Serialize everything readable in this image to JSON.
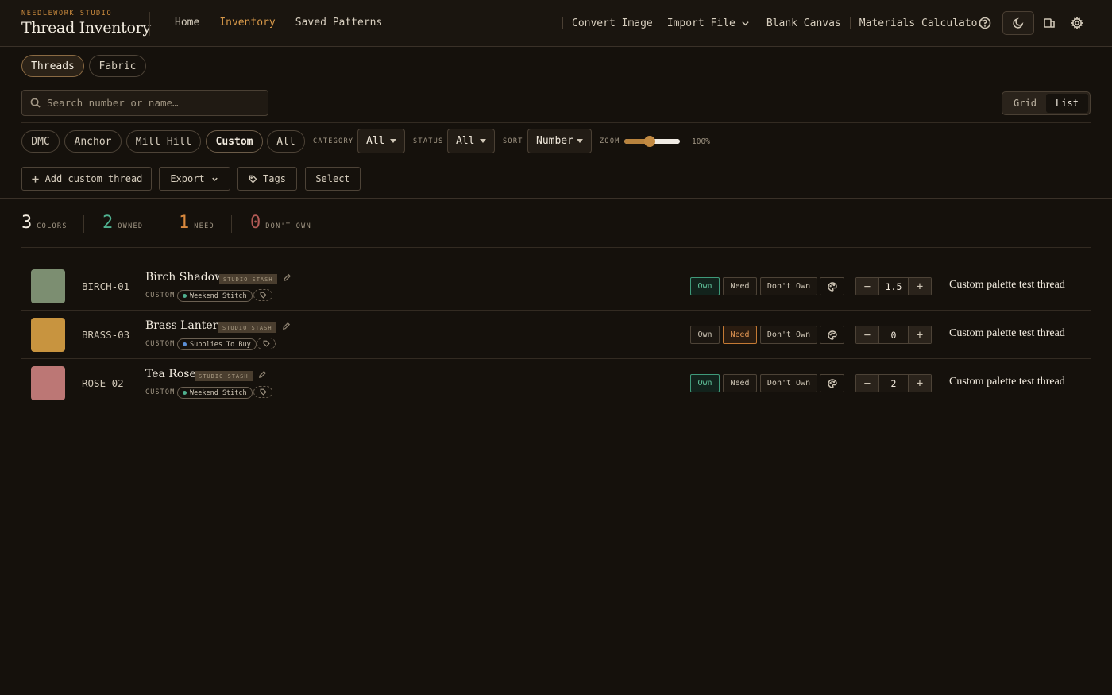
{
  "header": {
    "kicker": "NEEDLEWORK STUDIO",
    "title": "Thread Inventory",
    "nav": [
      "Home",
      "Inventory",
      "Saved Patterns"
    ],
    "active_nav": "Inventory",
    "right_nav": {
      "convert": "Convert Image",
      "import": "Import File",
      "blank": "Blank Canvas",
      "materials": "Materials Calculator"
    },
    "icons": [
      "help-icon",
      "moon-icon",
      "switch-view-icon",
      "gear-icon"
    ]
  },
  "tabs": {
    "items": [
      "Threads",
      "Fabric"
    ],
    "active": "Threads"
  },
  "search": {
    "placeholder": "Search number or name…",
    "value": ""
  },
  "view_toggle": {
    "grid": "Grid",
    "list": "List",
    "active": "List"
  },
  "brands": {
    "items": [
      "DMC",
      "Anchor",
      "Mill Hill",
      "Custom",
      "All"
    ],
    "active": "Custom"
  },
  "filters": {
    "category_label": "CATEGORY",
    "category_value": "All",
    "status_label": "STATUS",
    "status_value": "All",
    "sort_label": "SORT",
    "sort_value": "Number",
    "zoom_label": "ZOOM",
    "zoom_value": "100%",
    "zoom_fraction": 0.45
  },
  "actions": {
    "add": "Add custom thread",
    "export": "Export",
    "tags": "Tags",
    "select": "Select"
  },
  "stats": [
    {
      "value": "3",
      "label": "COLORS",
      "color": "#f3ece0"
    },
    {
      "value": "2",
      "label": "OWNED",
      "color": "#4fb08f"
    },
    {
      "value": "1",
      "label": "NEED",
      "color": "#d9893e"
    },
    {
      "value": "0",
      "label": "DON'T OWN",
      "color": "#b25a55"
    }
  ],
  "status_labels": {
    "own": "Own",
    "need": "Need",
    "dont_own": "Don't Own"
  },
  "threads": [
    {
      "code": "BIRCH-01",
      "name": "Birch Shadow",
      "badge": "STUDIO STASH",
      "brand": "CUSTOM",
      "tag": "Weekend Stitch",
      "tag_color": "#4fb08f",
      "swatch": "#7c8e71",
      "status": "own",
      "quantity": "1.5",
      "note": "Custom palette test thread"
    },
    {
      "code": "BRASS-03",
      "name": "Brass Lantern",
      "badge": "STUDIO STASH",
      "brand": "CUSTOM",
      "tag": "Supplies To Buy",
      "tag_color": "#5b8fd6",
      "swatch": "#c8943f",
      "status": "need",
      "quantity": "0",
      "note": "Custom palette test thread"
    },
    {
      "code": "ROSE-02",
      "name": "Tea Rose",
      "badge": "STUDIO STASH",
      "brand": "CUSTOM",
      "tag": "Weekend Stitch",
      "tag_color": "#4fb08f",
      "swatch": "#bc7775",
      "status": "own",
      "quantity": "2",
      "note": "Custom palette test thread"
    }
  ]
}
